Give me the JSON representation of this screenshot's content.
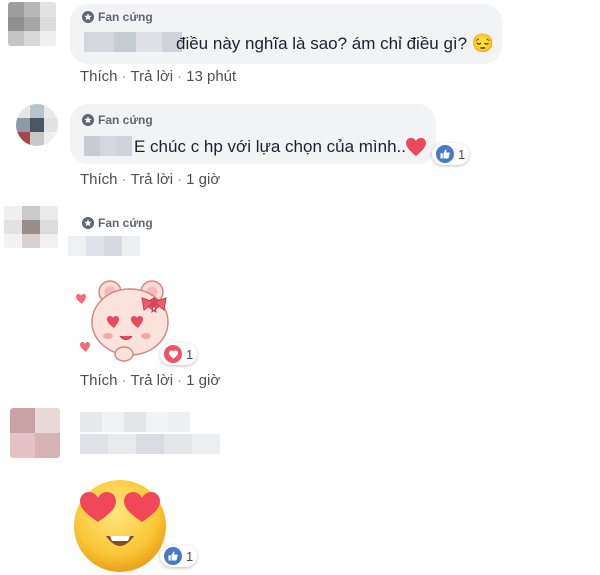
{
  "comments": [
    {
      "badge": "Fan cứng",
      "text": "điều này nghĩa là sao? ám chỉ điều gì?",
      "text_emoji": "😔",
      "actions": {
        "like": "Thích",
        "reply": "Trả lời",
        "time": "13 phút"
      }
    },
    {
      "badge": "Fan cứng",
      "text": "E chúc c hp với lựa chọn của mình..",
      "text_emoji": "❤",
      "reaction": {
        "icon": "like-icon",
        "count": "1"
      },
      "actions": {
        "like": "Thích",
        "reply": "Trả lời",
        "time": "1 giờ"
      }
    },
    {
      "badge": "Fan cứng",
      "sticker": "pink-bear-heart-eyes-sticker",
      "reaction": {
        "icon": "love-icon",
        "count": "1"
      },
      "actions": {
        "like": "Thích",
        "reply": "Trả lời",
        "time": "1 giờ"
      }
    },
    {
      "sticker": "heart-eyes-emoji-sticker",
      "reaction": {
        "icon": "like-icon",
        "count": "1"
      }
    }
  ],
  "separator": "·",
  "colors": {
    "like": "#4a78c9",
    "love": "#f25268",
    "bubble": "#f2f3f5",
    "badge_text": "#606770"
  }
}
